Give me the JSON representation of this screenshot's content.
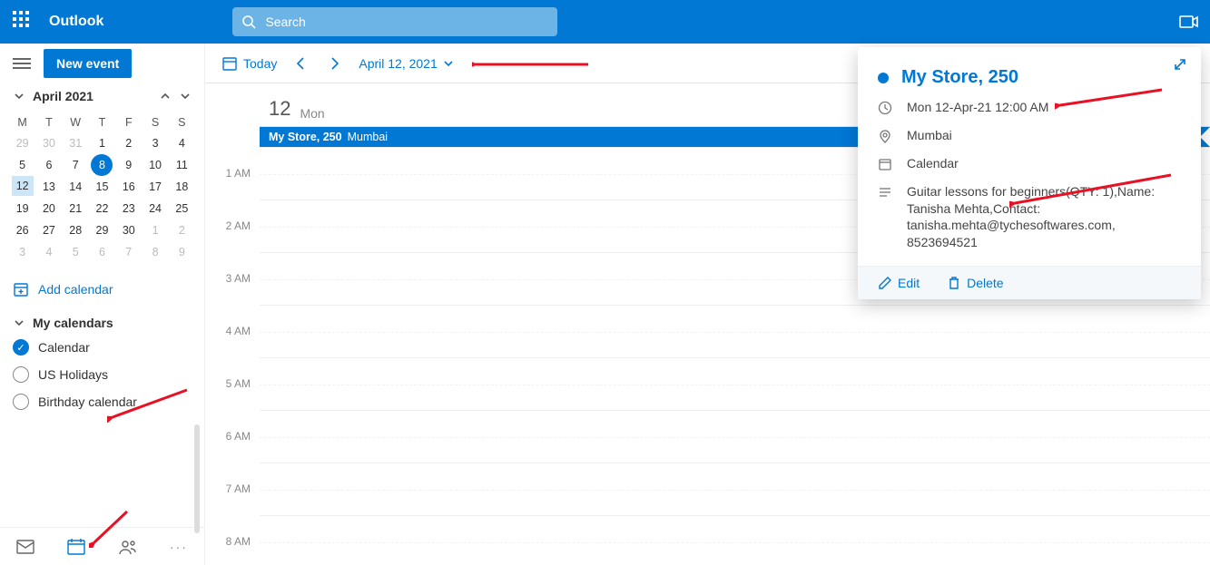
{
  "suite": {
    "appName": "Outlook",
    "searchPlaceholder": "Search"
  },
  "cmd": {
    "newEvent": "New event",
    "today": "Today",
    "date": "April 12, 2021"
  },
  "miniCalendar": {
    "month": "April 2021",
    "dow": [
      "M",
      "T",
      "W",
      "T",
      "F",
      "S",
      "S"
    ],
    "weeks": [
      [
        {
          "d": "29",
          "dim": true
        },
        {
          "d": "30",
          "dim": true
        },
        {
          "d": "31",
          "dim": true
        },
        {
          "d": "1"
        },
        {
          "d": "2"
        },
        {
          "d": "3"
        },
        {
          "d": "4"
        }
      ],
      [
        {
          "d": "5"
        },
        {
          "d": "6"
        },
        {
          "d": "7"
        },
        {
          "d": "8",
          "today": true
        },
        {
          "d": "9"
        },
        {
          "d": "10"
        },
        {
          "d": "11"
        }
      ],
      [
        {
          "d": "12",
          "sel": true
        },
        {
          "d": "13"
        },
        {
          "d": "14"
        },
        {
          "d": "15"
        },
        {
          "d": "16"
        },
        {
          "d": "17"
        },
        {
          "d": "18"
        }
      ],
      [
        {
          "d": "19"
        },
        {
          "d": "20"
        },
        {
          "d": "21"
        },
        {
          "d": "22"
        },
        {
          "d": "23"
        },
        {
          "d": "24"
        },
        {
          "d": "25"
        }
      ],
      [
        {
          "d": "26"
        },
        {
          "d": "27"
        },
        {
          "d": "28"
        },
        {
          "d": "29"
        },
        {
          "d": "30"
        },
        {
          "d": "1",
          "dim": true
        },
        {
          "d": "2",
          "dim": true
        }
      ],
      [
        {
          "d": "3",
          "dim": true
        },
        {
          "d": "4",
          "dim": true
        },
        {
          "d": "5",
          "dim": true
        },
        {
          "d": "6",
          "dim": true
        },
        {
          "d": "7",
          "dim": true
        },
        {
          "d": "8",
          "dim": true
        },
        {
          "d": "9",
          "dim": true
        }
      ]
    ]
  },
  "sidebar": {
    "addCalendar": "Add calendar",
    "myCalendars": "My calendars",
    "calendars": [
      "Calendar",
      "US Holidays",
      "Birthday calendar"
    ]
  },
  "dayView": {
    "dayNumber": "12",
    "dayName": "Mon",
    "hours": [
      "1 AM",
      "2 AM",
      "3 AM",
      "4 AM",
      "5 AM",
      "6 AM",
      "7 AM",
      "8 AM"
    ],
    "event": {
      "title": "My Store, 250",
      "location": "Mumbai"
    }
  },
  "popup": {
    "title": "My Store, 250",
    "time": "Mon 12-Apr-21 12:00 AM",
    "location": "Mumbai",
    "calendar": "Calendar",
    "description": "Guitar lessons for beginners(QTY: 1),Name: Tanisha Mehta,Contact: tanisha.mehta@tychesoftwares.com, 8523694521",
    "edit": "Edit",
    "delete": "Delete"
  }
}
